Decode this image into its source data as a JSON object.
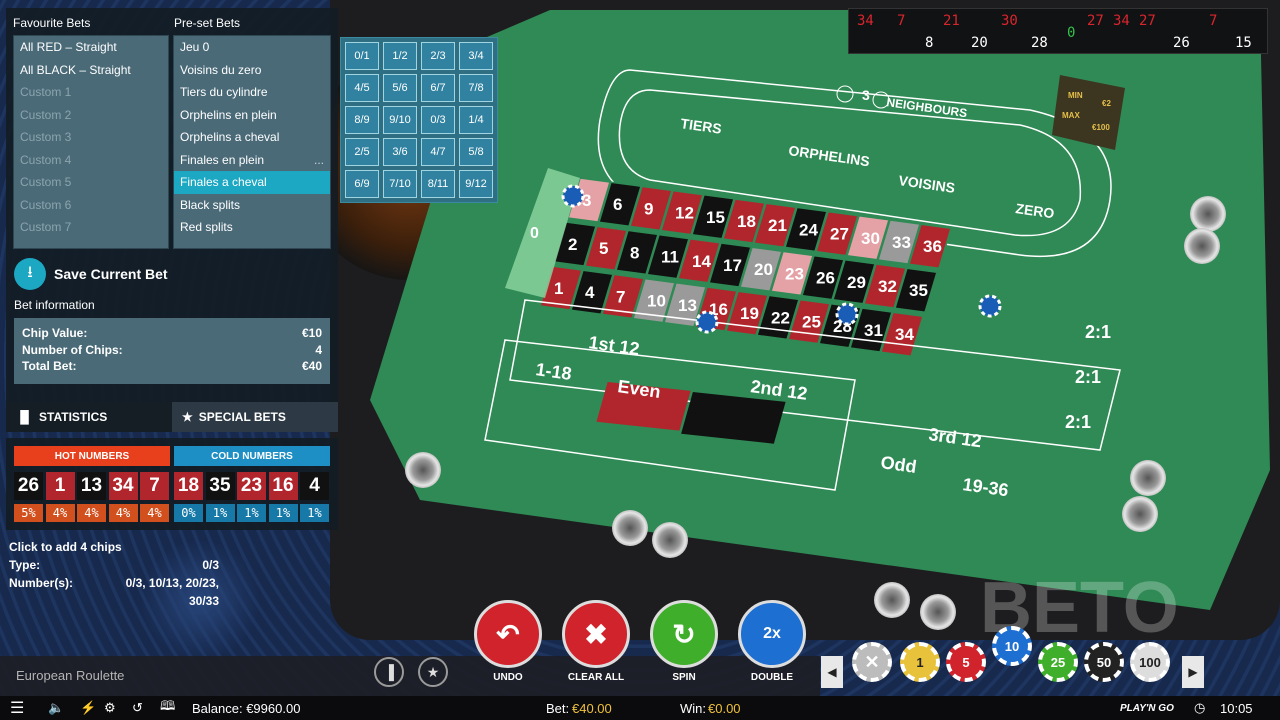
{
  "favourite_bets": {
    "title": "Favourite Bets",
    "items": [
      "All RED – Straight",
      "All BLACK – Straight",
      "Custom 1",
      "Custom 2",
      "Custom 3",
      "Custom 4",
      "Custom 5",
      "Custom 6",
      "Custom 7"
    ]
  },
  "preset_bets": {
    "title": "Pre-set Bets",
    "items": [
      "Jeu 0",
      "Voisins du zero",
      "Tiers du cylindre",
      "Orphelins en plein",
      "Orphelins a cheval",
      "Finales en plein",
      "Finales a cheval",
      "Black splits",
      "Red splits"
    ],
    "active_index": 6,
    "more": "..."
  },
  "splits": [
    "0/1",
    "1/2",
    "2/3",
    "3/4",
    "4/5",
    "5/6",
    "6/7",
    "7/8",
    "8/9",
    "9/10",
    "0/3",
    "1/4",
    "2/5",
    "3/6",
    "4/7",
    "5/8",
    "6/9",
    "7/10",
    "8/11",
    "9/12"
  ],
  "save_bet": {
    "label": "Save Current Bet"
  },
  "bet_info": {
    "title": "Bet information",
    "rows": [
      {
        "label": "Chip Value:",
        "value": "€10"
      },
      {
        "label": "Number of Chips:",
        "value": "4"
      },
      {
        "label": "Total Bet:",
        "value": "€40"
      }
    ]
  },
  "tabs": {
    "statistics": "STATISTICS",
    "special_bets": "SPECIAL BETS"
  },
  "hot": {
    "title": "HOT NUMBERS",
    "numbers": [
      "26",
      "1",
      "13",
      "34",
      "7"
    ],
    "colors": [
      "#111111",
      "#b1262c",
      "#111111",
      "#b1262c",
      "#b1262c"
    ],
    "pcts": [
      "5%",
      "4%",
      "4%",
      "4%",
      "4%"
    ]
  },
  "cold": {
    "title": "COLD NUMBERS",
    "numbers": [
      "18",
      "35",
      "23",
      "16",
      "4"
    ],
    "colors": [
      "#b1262c",
      "#111111",
      "#b1262c",
      "#b1262c",
      "#111111"
    ],
    "pcts": [
      "0%",
      "1%",
      "1%",
      "1%",
      "1%"
    ]
  },
  "bet_detail": {
    "prompt": "Click to add 4 chips",
    "type_label": "Type:",
    "type_value": "0/3",
    "numbers_label": "Number(s):",
    "numbers_value_1": "0/3, 10/13, 20/23,",
    "numbers_value_2": "30/33"
  },
  "history": {
    "red": [
      "34",
      "7",
      "21",
      "30",
      "27",
      "34",
      "27",
      "7"
    ],
    "black": [
      "8",
      "20",
      "28",
      "26",
      "15"
    ],
    "green": [
      "0"
    ]
  },
  "table": {
    "neighbours_label": "NEIGHBOURS",
    "neighbours_count": "3",
    "min_label": "MIN",
    "min_value": "€2",
    "max_label": "MAX",
    "max_value": "€100",
    "tiers": "TIERS",
    "orphelins": "ORPHELINS",
    "voisins": "VOISINS",
    "zero": "ZERO",
    "dozen1": "1st 12",
    "dozen2": "2nd 12",
    "dozen3": "3rd 12",
    "low": "1-18",
    "even": "Even",
    "odd": "Odd",
    "high": "19-36",
    "col": "2:1",
    "watermark": "BETO"
  },
  "controls": {
    "undo": "UNDO",
    "clear_all": "CLEAR ALL",
    "spin": "SPIN",
    "double": "DOUBLE",
    "double_icon": "2x"
  },
  "chips": [
    "1",
    "5",
    "10",
    "25",
    "50",
    "100"
  ],
  "game_name": "European Roulette",
  "status": {
    "balance": "Balance: €9960.00",
    "bet_label": "Bet:",
    "bet_value": "€40.00",
    "win_label": "Win:",
    "win_value": "€0.00",
    "brand": "PLAY'N GO",
    "time": "10:05"
  },
  "colors": {
    "red": "#b1262c",
    "black": "#111111",
    "felt": "#2f8a55",
    "accent": "#1ca7c2"
  }
}
